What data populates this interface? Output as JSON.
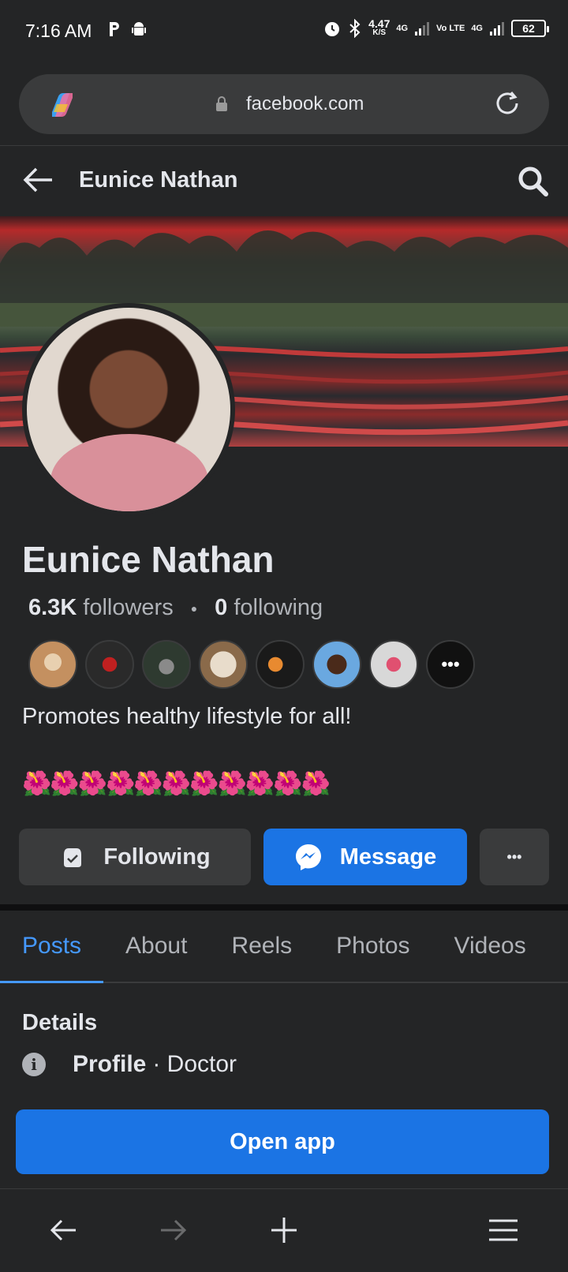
{
  "status_bar": {
    "time": "7:16 AM",
    "speed_value": "4.47",
    "speed_unit": "K/S",
    "net1": "4G",
    "volte": "Vo LTE",
    "net2": "4G",
    "battery": "62"
  },
  "browser": {
    "url": "facebook.com"
  },
  "header": {
    "title": "Eunice Nathan"
  },
  "profile": {
    "name": "Eunice Nathan",
    "followers_count": "6.3K",
    "followers_label": "followers",
    "following_count": "0",
    "following_label": "following",
    "bio": "Promotes healthy lifestyle for all!",
    "emoji_line": "🌺🌺🌺🌺🌺🌺🌺🌺🌺🌺🌺"
  },
  "actions": {
    "following_label": "Following",
    "message_label": "Message",
    "more_label": "•••"
  },
  "tabs": [
    {
      "label": "Posts",
      "active": true
    },
    {
      "label": "About",
      "active": false
    },
    {
      "label": "Reels",
      "active": false
    },
    {
      "label": "Photos",
      "active": false
    },
    {
      "label": "Videos",
      "active": false
    }
  ],
  "details": {
    "title": "Details",
    "row_key": "Profile",
    "row_value": "· Doctor"
  },
  "open_app_label": "Open app",
  "colors": {
    "background": "#242526",
    "accent": "#1b74e4",
    "tab_active": "#4599ff"
  }
}
